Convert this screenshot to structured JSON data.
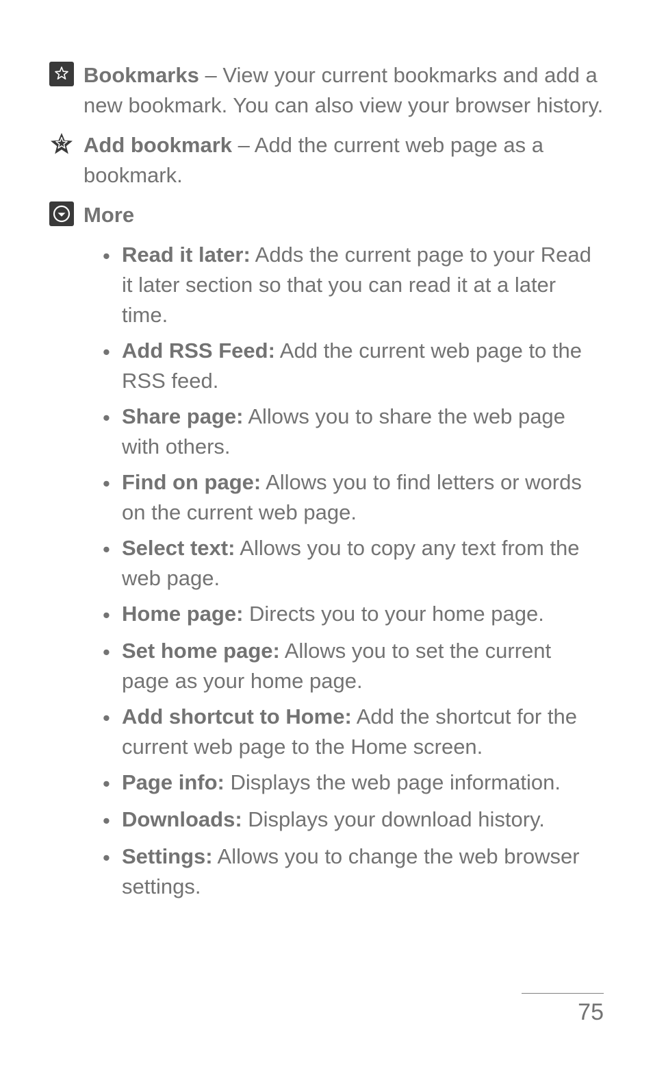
{
  "entries": [
    {
      "icon": "bookmarks-list-icon",
      "title": "Bookmarks",
      "sep": " – ",
      "desc": "View your current bookmarks and add a new bookmark. You can also view your browser history."
    },
    {
      "icon": "add-bookmark-star-icon",
      "title": "Add bookmark",
      "sep": " – ",
      "desc": "Add the current web page as a bookmark."
    },
    {
      "icon": "more-dropdown-icon",
      "title": "More",
      "sep": "",
      "desc": ""
    }
  ],
  "more_items": [
    {
      "title": "Read it later:",
      "desc": " Adds the current page to your Read it later section so that you can read it at a later time."
    },
    {
      "title": "Add RSS Feed:",
      "desc": " Add the current web page to the RSS feed."
    },
    {
      "title": "Share page:",
      "desc": " Allows you to share the web page with others."
    },
    {
      "title": "Find on page:",
      "desc": " Allows you to find letters or words on the current web page."
    },
    {
      "title": "Select text:",
      "desc": " Allows you to copy any text from the web page."
    },
    {
      "title": "Home page:",
      "desc": " Directs you to your home page."
    },
    {
      "title": "Set home page:",
      "desc": " Allows you to set the current page as your home page."
    },
    {
      "title": "Add shortcut to Home:",
      "desc": " Add the shortcut for the current web page to the Home screen."
    },
    {
      "title": "Page info:",
      "desc": " Displays the web page information."
    },
    {
      "title": "Downloads:",
      "desc": " Displays your download history."
    },
    {
      "title": "Settings:",
      "desc": " Allows you to change the web browser settings."
    }
  ],
  "bullet": "•",
  "page_number": "75"
}
